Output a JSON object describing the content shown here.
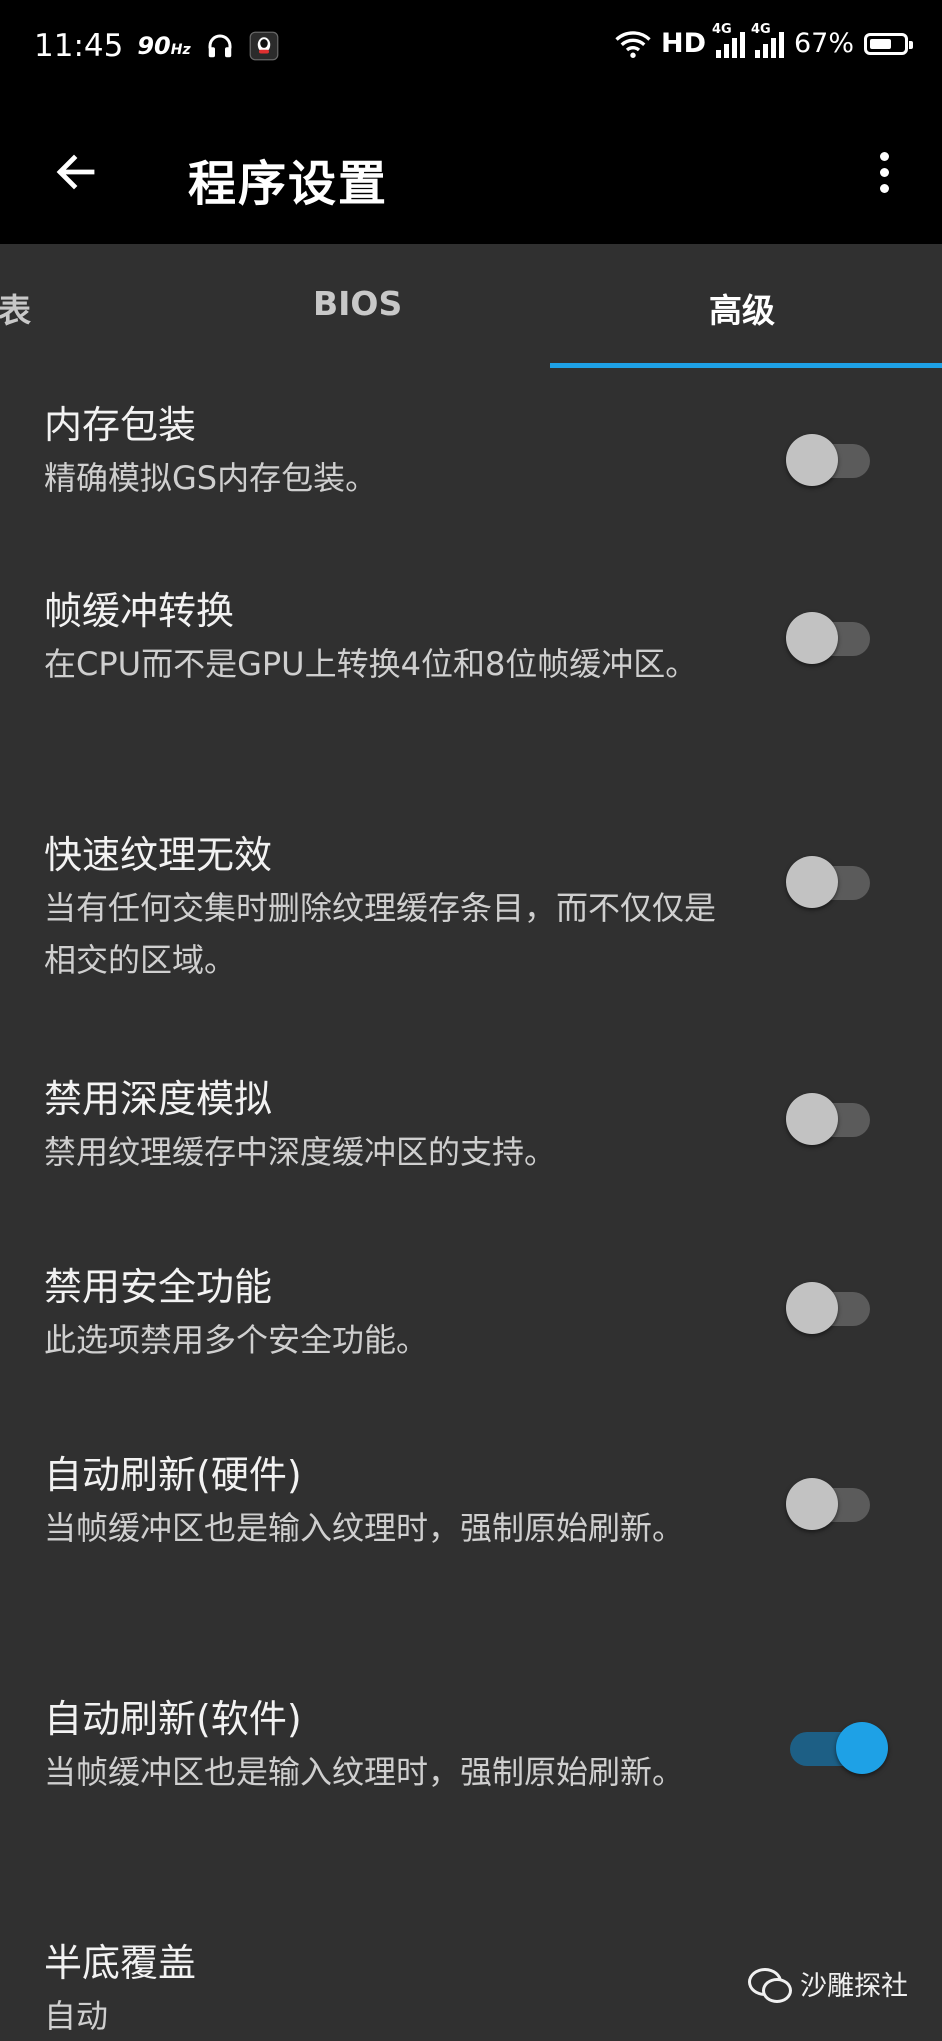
{
  "status_bar": {
    "time": "11:45",
    "refresh_rate": "90",
    "refresh_unit": "Hz",
    "hd_label": "HD",
    "network_1": "4G",
    "network_2": "4G",
    "battery": "67%",
    "battery_level": 0.67
  },
  "app_bar": {
    "title": "程序设置"
  },
  "tabs": [
    {
      "label": "表"
    },
    {
      "label": "BIOS"
    },
    {
      "label": "高级"
    }
  ],
  "settings": [
    {
      "title": "内存包装",
      "desc": "精确模拟GS内存包装。",
      "enabled": false
    },
    {
      "title": "帧缓冲转换",
      "desc": "在CPU而不是GPU上转换4位和8位帧缓冲区。",
      "enabled": false
    },
    {
      "title": "快速纹理无效",
      "desc": "当有任何交集时删除纹理缓存条目，而不仅仅是相交的区域。",
      "enabled": false
    },
    {
      "title": "禁用深度模拟",
      "desc": "禁用纹理缓存中深度缓冲区的支持。",
      "enabled": false
    },
    {
      "title": "禁用安全功能",
      "desc": "此选项禁用多个安全功能。",
      "enabled": false
    },
    {
      "title": "自动刷新(硬件)",
      "desc": "当帧缓冲区也是输入纹理时，强制原始刷新。",
      "enabled": false
    },
    {
      "title": "自动刷新(软件)",
      "desc": "当帧缓冲区也是输入纹理时，强制原始刷新。",
      "enabled": true
    },
    {
      "title": "半底覆盖",
      "desc": "自动"
    }
  ],
  "watermark": {
    "text": "沙雕探社"
  },
  "colors": {
    "accent": "#1ea1e6",
    "background": "#303030",
    "bar": "#000000"
  }
}
